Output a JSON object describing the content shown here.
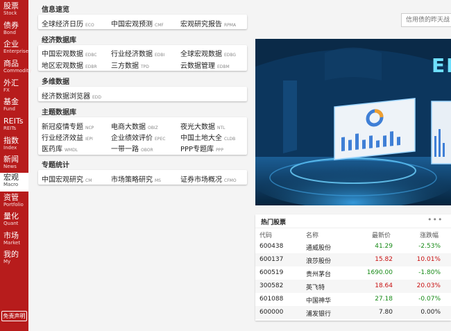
{
  "sidebar": {
    "items": [
      {
        "cn": "股票",
        "en": "Stock"
      },
      {
        "cn": "债券",
        "en": "Bond"
      },
      {
        "cn": "企业",
        "en": "Enterprise"
      },
      {
        "cn": "商品",
        "en": "Commodity"
      },
      {
        "cn": "外汇",
        "en": "FX"
      },
      {
        "cn": "基金",
        "en": "Fund"
      },
      {
        "cn": "REITs",
        "en": "REITs"
      },
      {
        "cn": "指数",
        "en": "Index"
      },
      {
        "cn": "新闻",
        "en": "News"
      },
      {
        "cn": "宏观",
        "en": "Macro"
      },
      {
        "cn": "资管",
        "en": "Portfolio"
      },
      {
        "cn": "量化",
        "en": "Quant"
      },
      {
        "cn": "市场",
        "en": "Market"
      },
      {
        "cn": "我的",
        "en": "My"
      }
    ],
    "active": "宏观",
    "disclaimer": "免责声明"
  },
  "menu": {
    "info": {
      "title": "信息速览",
      "links": [
        {
          "label": "全球经济日历",
          "code": "ECO"
        },
        {
          "label": "中国宏观预测",
          "code": "CMF"
        },
        {
          "label": "宏观研究报告",
          "code": "RPMA"
        }
      ]
    },
    "economic_db": {
      "title": "经济数据库",
      "links": [
        {
          "label": "中国宏观数据",
          "code": "EDBC"
        },
        {
          "label": "行业经济数据",
          "code": "EDBI"
        },
        {
          "label": "全球宏观数据",
          "code": "EDBG"
        },
        {
          "label": "地区宏观数据",
          "code": "EDBR"
        },
        {
          "label": "三方数据",
          "code": "TPD"
        },
        {
          "label": "云数据管理",
          "code": "EDBM"
        }
      ]
    },
    "multi": {
      "title": "多维数据",
      "links": [
        {
          "label": "经济数据浏览器",
          "code": "EDD"
        }
      ]
    },
    "thematic": {
      "title": "主题数据库",
      "links": [
        {
          "label": "新冠疫情专题",
          "code": "NCP"
        },
        {
          "label": "电商大数据",
          "code": "OBIZ"
        },
        {
          "label": "夜光大数据",
          "code": "NTL"
        },
        {
          "label": "行业经济效益",
          "code": "IEPI"
        },
        {
          "label": "企业绩效评价",
          "code": "EPEC"
        },
        {
          "label": "中国土地大全",
          "code": "CLDB"
        },
        {
          "label": "医药库",
          "code": "WMDL"
        },
        {
          "label": "一带一路",
          "code": "OBOR"
        },
        {
          "label": "PPP专题库",
          "code": "PPP"
        }
      ]
    },
    "special": {
      "title": "专题统计",
      "links": [
        {
          "label": "中国宏观研究",
          "code": "CM"
        },
        {
          "label": "市场策略研究",
          "code": "MS"
        },
        {
          "label": "证券市场概况",
          "code": "CFMO"
        }
      ]
    }
  },
  "search": {
    "placeholder": "信用债的昨天战"
  },
  "banner": {
    "text": "ED"
  },
  "hot_stocks": {
    "title": "热门股票",
    "headers": [
      "代码",
      "名称",
      "最新价",
      "涨跌幅"
    ],
    "rows": [
      {
        "code": "600438",
        "name": "通威股份",
        "price": "41.29",
        "change": "-2.53%",
        "trend": "down"
      },
      {
        "code": "600137",
        "name": "浪莎股份",
        "price": "15.82",
        "change": "10.01%",
        "trend": "up"
      },
      {
        "code": "600519",
        "name": "贵州茅台",
        "price": "1690.00",
        "change": "-1.80%",
        "trend": "down"
      },
      {
        "code": "300582",
        "name": "英飞特",
        "price": "18.64",
        "change": "20.03%",
        "trend": "up"
      },
      {
        "code": "601088",
        "name": "中国神华",
        "price": "27.18",
        "change": "-0.07%",
        "trend": "down"
      },
      {
        "code": "600000",
        "name": "浦发银行",
        "price": "7.80",
        "change": "0.00%",
        "trend": "flat"
      }
    ]
  }
}
